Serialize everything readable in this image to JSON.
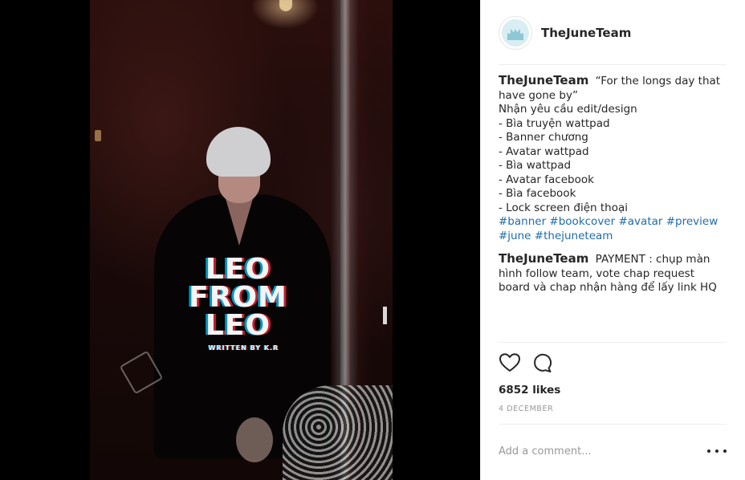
{
  "post_image": {
    "title_lines": [
      "LEO",
      "FROM",
      "LEO"
    ],
    "credit": "WRITTEN BY K.R"
  },
  "header": {
    "username": "TheJuneTeam"
  },
  "comments": [
    {
      "username": "TheJuneTeam",
      "lines": [
        "“For the longs day that have gone by”",
        "Nhận yêu cầu edit/design",
        "- Bìa truyện wattpad",
        "- Banner chương",
        "- Avatar wattpad",
        "- Bìa wattpad",
        "- Avatar facebook",
        "- Bìa facebook",
        "- Lock screen điện thoại"
      ],
      "hashtags": [
        "#banner",
        "#bookcover",
        "#avatar",
        "#preview",
        "#june",
        "#thejuneteam"
      ]
    },
    {
      "username": "TheJuneTeam",
      "text": "PAYMENT : chụp màn hình follow team, vote chap request board và chap nhận hàng để lấy link HQ"
    }
  ],
  "actions": {
    "like_icon": "heart-icon",
    "comment_icon": "comment-bubble-icon"
  },
  "likes": "6852 likes",
  "date": "4 DECEMBER",
  "add_comment": {
    "placeholder": "Add a comment..."
  },
  "more_icon": "more-dots-icon"
}
